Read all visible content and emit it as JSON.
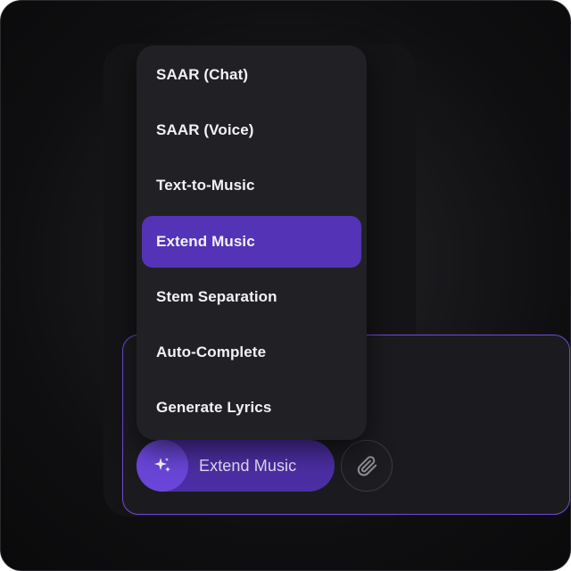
{
  "dropdown": {
    "items": [
      {
        "label": "SAAR (Chat)",
        "selected": false
      },
      {
        "label": "SAAR (Voice)",
        "selected": false
      },
      {
        "label": "Text-to-Music",
        "selected": false
      },
      {
        "label": "Extend Music",
        "selected": true
      },
      {
        "label": "Stem Separation",
        "selected": false
      },
      {
        "label": "Auto-Complete",
        "selected": false
      },
      {
        "label": "Generate Lyrics",
        "selected": false
      }
    ]
  },
  "composer": {
    "mode_button": {
      "label": "Extend Music",
      "icon": "sparkle-icon"
    },
    "attach_button": {
      "icon": "paperclip-icon"
    }
  },
  "colors": {
    "accent": "#5433b6",
    "accent_light": "#6a46d8",
    "surface": "#212125",
    "background": "#0f0f11"
  }
}
